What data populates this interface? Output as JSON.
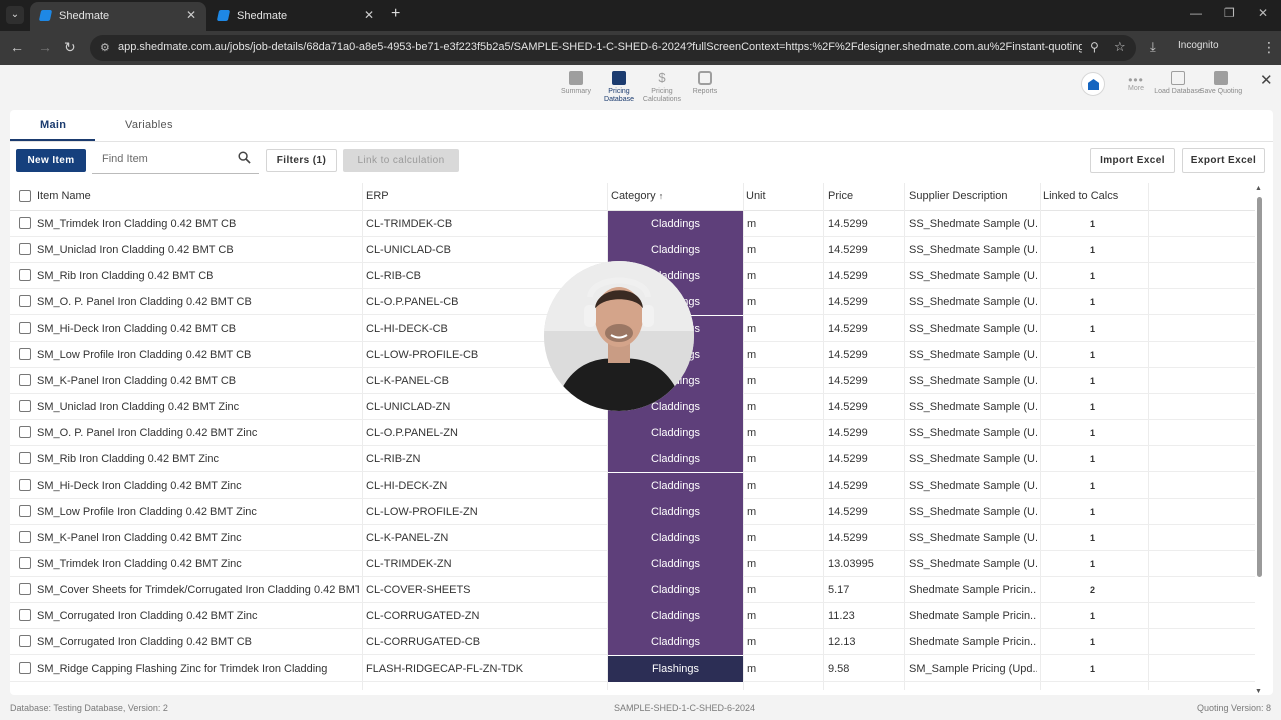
{
  "browser": {
    "tabs": [
      {
        "title": "Shedmate",
        "active": true
      },
      {
        "title": "Shedmate",
        "active": false
      }
    ],
    "url": "app.shedmate.com.au/jobs/job-details/68da71a0-a8e5-4953-be71-e3f223f5b2a5/SAMPLE-SHED-1-C-SHED-6-2024?fullScreenContext=https:%2F%2Fdesigner.shedmate.com.au%2Finstant-quoting&compan...",
    "incognito_label": "Incognito"
  },
  "app_nav": {
    "items": [
      {
        "label": "Summary",
        "active": false
      },
      {
        "label": "Pricing Database",
        "active": true
      },
      {
        "label": "Pricing Calculations",
        "active": false
      },
      {
        "label": "Reports",
        "active": false
      }
    ],
    "more_label": "More",
    "load_label": "Load Database",
    "save_label": "Save Quoting"
  },
  "tabs": {
    "main": "Main",
    "variables": "Variables"
  },
  "toolbar": {
    "new_item": "New Item",
    "search_placeholder": "Find Item",
    "filters": "Filters (1)",
    "link": "Link to calculation",
    "import": "Import Excel",
    "export": "Export Excel"
  },
  "table": {
    "headers": {
      "name": "Item Name",
      "erp": "ERP",
      "category": "Category",
      "sort_indicator": "↑",
      "unit": "Unit",
      "price": "Price",
      "supplier": "Supplier Description",
      "linked": "Linked to Calcs"
    },
    "category_colors": {
      "Claddings": "#5e3f7a",
      "Flashings": "#2c2e55"
    },
    "rows": [
      {
        "name": "SM_Trimdek Iron Cladding 0.42 BMT CB",
        "erp": "CL-TRIMDEK-CB",
        "category": "Claddings",
        "unit": "m",
        "price": "14.5299",
        "supplier": "SS_Shedmate Sample (U...",
        "linked": "1"
      },
      {
        "name": "SM_Uniclad Iron Cladding 0.42 BMT CB",
        "erp": "CL-UNICLAD-CB",
        "category": "Claddings",
        "unit": "m",
        "price": "14.5299",
        "supplier": "SS_Shedmate Sample (U...",
        "linked": "1"
      },
      {
        "name": "SM_Rib Iron Cladding 0.42 BMT CB",
        "erp": "CL-RIB-CB",
        "category": "Claddings",
        "unit": "m",
        "price": "14.5299",
        "supplier": "SS_Shedmate Sample (U...",
        "linked": "1"
      },
      {
        "name": "SM_O. P. Panel Iron Cladding 0.42 BMT CB",
        "erp": "CL-O.P.PANEL-CB",
        "category": "Claddings",
        "unit": "m",
        "price": "14.5299",
        "supplier": "SS_Shedmate Sample (U...",
        "linked": "1"
      },
      {
        "name": "SM_Hi-Deck Iron Cladding 0.42 BMT CB",
        "erp": "CL-HI-DECK-CB",
        "category": "Claddings",
        "unit": "m",
        "price": "14.5299",
        "supplier": "SS_Shedmate Sample (U...",
        "linked": "1"
      },
      {
        "name": "SM_Low Profile Iron Cladding 0.42 BMT CB",
        "erp": "CL-LOW-PROFILE-CB",
        "category": "Claddings",
        "unit": "m",
        "price": "14.5299",
        "supplier": "SS_Shedmate Sample (U...",
        "linked": "1"
      },
      {
        "name": "SM_K-Panel Iron Cladding 0.42 BMT CB",
        "erp": "CL-K-PANEL-CB",
        "category": "Claddings",
        "unit": "m",
        "price": "14.5299",
        "supplier": "SS_Shedmate Sample (U...",
        "linked": "1"
      },
      {
        "name": "SM_Uniclad Iron Cladding 0.42 BMT Zinc",
        "erp": "CL-UNICLAD-ZN",
        "category": "Claddings",
        "unit": "m",
        "price": "14.5299",
        "supplier": "SS_Shedmate Sample (U...",
        "linked": "1"
      },
      {
        "name": "SM_O. P. Panel Iron Cladding 0.42 BMT Zinc",
        "erp": "CL-O.P.PANEL-ZN",
        "category": "Claddings",
        "unit": "m",
        "price": "14.5299",
        "supplier": "SS_Shedmate Sample (U...",
        "linked": "1"
      },
      {
        "name": "SM_Rib Iron Cladding 0.42 BMT Zinc",
        "erp": "CL-RIB-ZN",
        "category": "Claddings",
        "unit": "m",
        "price": "14.5299",
        "supplier": "SS_Shedmate Sample (U...",
        "linked": "1"
      },
      {
        "name": "SM_Hi-Deck Iron Cladding 0.42 BMT Zinc",
        "erp": "CL-HI-DECK-ZN",
        "category": "Claddings",
        "unit": "m",
        "price": "14.5299",
        "supplier": "SS_Shedmate Sample (U...",
        "linked": "1"
      },
      {
        "name": "SM_Low Profile Iron Cladding 0.42 BMT Zinc",
        "erp": "CL-LOW-PROFILE-ZN",
        "category": "Claddings",
        "unit": "m",
        "price": "14.5299",
        "supplier": "SS_Shedmate Sample (U...",
        "linked": "1"
      },
      {
        "name": "SM_K-Panel Iron Cladding 0.42 BMT Zinc",
        "erp": "CL-K-PANEL-ZN",
        "category": "Claddings",
        "unit": "m",
        "price": "14.5299",
        "supplier": "SS_Shedmate Sample (U...",
        "linked": "1"
      },
      {
        "name": "SM_Trimdek Iron Cladding 0.42 BMT Zinc",
        "erp": "CL-TRIMDEK-ZN",
        "category": "Claddings",
        "unit": "m",
        "price": "13.03995",
        "supplier": "SS_Shedmate Sample (U...",
        "linked": "1"
      },
      {
        "name": "SM_Cover Sheets for Trimdek/Corrugated Iron Cladding 0.42 BMT",
        "erp": "CL-COVER-SHEETS",
        "category": "Claddings",
        "unit": "m",
        "price": "5.17",
        "supplier": "Shedmate Sample Pricin...",
        "linked": "2"
      },
      {
        "name": "SM_Corrugated Iron Cladding 0.42 BMT Zinc",
        "erp": "CL-CORRUGATED-ZN",
        "category": "Claddings",
        "unit": "m",
        "price": "11.23",
        "supplier": "Shedmate Sample Pricin...",
        "linked": "1"
      },
      {
        "name": "SM_Corrugated Iron Cladding 0.42 BMT CB",
        "erp": "CL-CORRUGATED-CB",
        "category": "Claddings",
        "unit": "m",
        "price": "12.13",
        "supplier": "Shedmate Sample Pricin...",
        "linked": "1"
      },
      {
        "name": "SM_Ridge Capping Flashing Zinc for Trimdek Iron Cladding",
        "erp": "FLASH-RIDGECAP-FL-ZN-TDK",
        "category": "Flashings",
        "unit": "m",
        "price": "9.58",
        "supplier": "SM_Sample Pricing (Upd...",
        "linked": "1"
      }
    ]
  },
  "footer": {
    "database": "Database: Testing Database, Version: 2",
    "job": "SAMPLE-SHED-1-C-SHED-6-2024",
    "quoting_version": "Quoting Version: 8"
  }
}
